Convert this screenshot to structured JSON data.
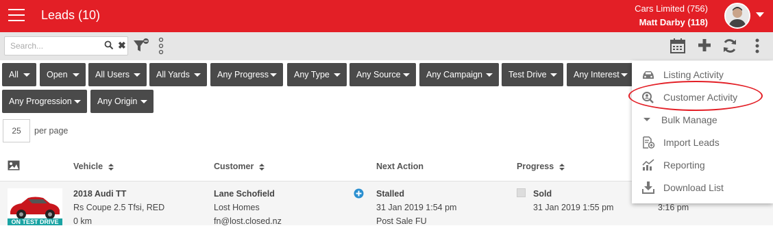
{
  "header": {
    "title": "Leads (10)",
    "account_company": "Cars Limited (756)",
    "account_user": "Matt Darby (118)"
  },
  "toolbar": {
    "search_placeholder": "Search...",
    "clear_label": "✖"
  },
  "filters": [
    {
      "label": "All"
    },
    {
      "label": "Open"
    },
    {
      "label": "All Users"
    },
    {
      "label": "All Yards"
    },
    {
      "label": "Any Progress"
    },
    {
      "label": "Any Type"
    },
    {
      "label": "Any Source"
    },
    {
      "label": "Any Campaign"
    },
    {
      "label": "Test Drive"
    },
    {
      "label": "Any Interest"
    },
    {
      "label": "Any Progression"
    },
    {
      "label": "Any Origin"
    }
  ],
  "pagination": {
    "per_page_value": "25",
    "per_page_label": "per page"
  },
  "table": {
    "columns": [
      "Vehicle",
      "Customer",
      "Next Action",
      "Progress"
    ],
    "rows": [
      {
        "image_tag": "ON TEST DRIVE",
        "vehicle_title": "2018 Audi TT",
        "vehicle_desc": "Rs Coupe 2.5 Tfsi, RED",
        "vehicle_km": "0 km",
        "customer_name": "Lane Schofield",
        "customer_company": "Lost Homes",
        "customer_email": "fn@lost.closed.nz",
        "next_action_status": "Stalled",
        "next_action_date": "31 Jan 2019 1:54 pm",
        "next_action_note": "Post Sale FU",
        "progress_status": "Sold",
        "progress_date": "31 Jan 2019 1:55 pm",
        "extra_time": "3:16 pm"
      }
    ]
  },
  "menu": {
    "items": [
      {
        "label": "Listing Activity",
        "icon": "car-icon"
      },
      {
        "label": "Customer Activity",
        "icon": "search-person-icon"
      },
      {
        "label": "Bulk Manage",
        "icon": "caret-down-icon"
      },
      {
        "label": "Import Leads",
        "icon": "import-icon"
      },
      {
        "label": "Reporting",
        "icon": "chart-icon"
      },
      {
        "label": "Download List",
        "icon": "download-icon"
      }
    ]
  },
  "colors": {
    "brand_red": "#e31f26",
    "filter_bg": "#4a4a4a",
    "toolbar_bg": "#e6e6e6",
    "add_blue": "#2a8fd0",
    "tag_teal": "#1aa3a3"
  }
}
